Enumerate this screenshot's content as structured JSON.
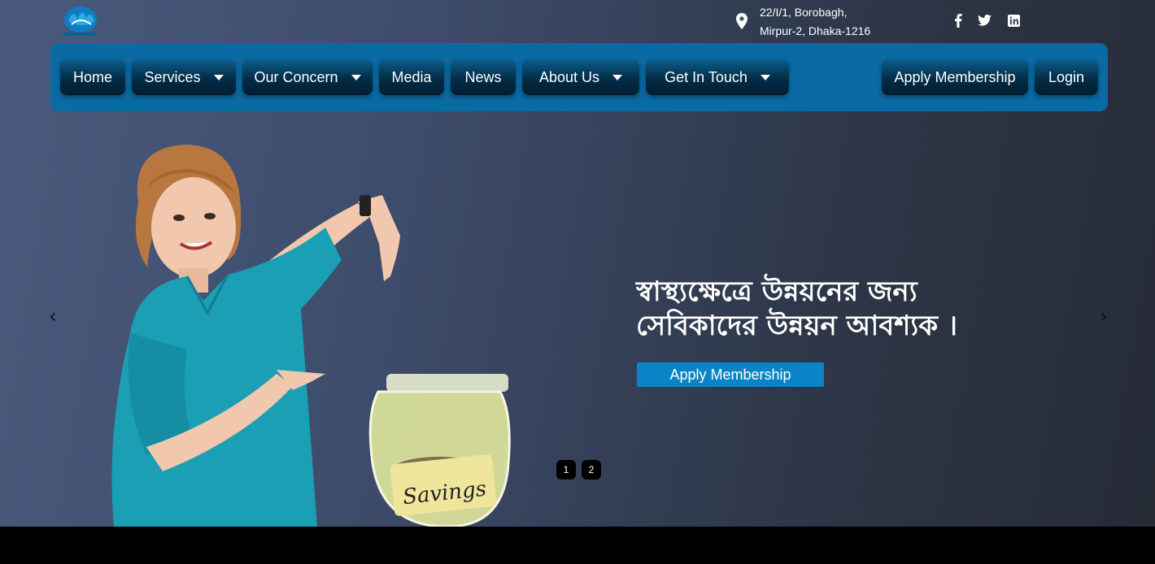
{
  "header": {
    "logo_icon": "foundation-logo-icon",
    "address_line1": "22/I/1, Borobagh,",
    "address_line2": "Mirpur-2, Dhaka-1216",
    "social": [
      "facebook-icon",
      "twitter-icon",
      "linkedin-icon"
    ]
  },
  "nav": {
    "items": [
      {
        "label": "Home"
      },
      {
        "label": "Services"
      },
      {
        "label": "Our Concern"
      },
      {
        "label": "Media"
      },
      {
        "label": "News"
      },
      {
        "label": "About Us"
      },
      {
        "label": "Get In Touch"
      }
    ],
    "apply_label": "Apply Membership",
    "login_label": "Login"
  },
  "hero": {
    "headline_line1": "স্বাস্থ্যক্ষেত্রে উন্নয়নের জন্য",
    "headline_line2": "সেবিকাদের উন্নয়ন আবশ্যক ।",
    "cta_label": "Apply Membership",
    "jar_label": "Savings",
    "prev": "‹",
    "next": "›",
    "dots": [
      "1",
      "2"
    ]
  },
  "colors": {
    "nav_bg": "#0a6aa4",
    "button_dark": "#032c46",
    "cta": "#0a84c6",
    "scrub_top": "#1aa3b8"
  }
}
